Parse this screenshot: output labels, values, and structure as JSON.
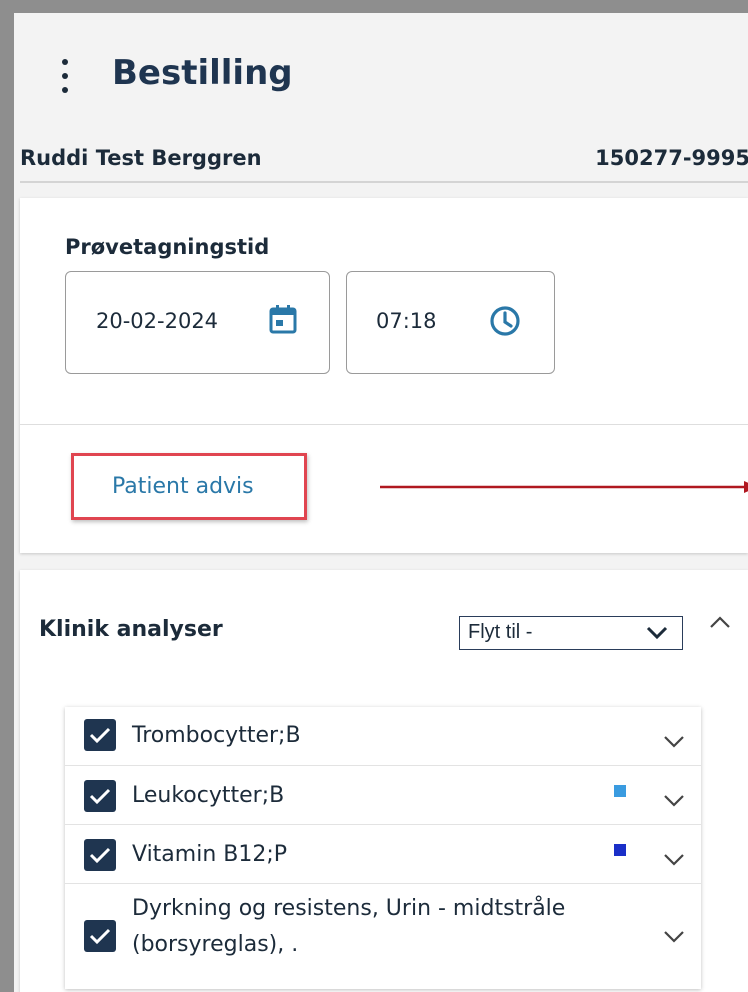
{
  "header": {
    "title": "Bestilling",
    "menu_icon": "kebab-menu-icon"
  },
  "patient": {
    "name": "Ruddi Test Berggren",
    "id": "150277-9995"
  },
  "sampling": {
    "label": "Prøvetagningstid",
    "date": "20-02-2024",
    "time": "07:18",
    "date_icon": "calendar-icon",
    "time_icon": "clock-icon"
  },
  "advis": {
    "label": "Patient advis",
    "highlight_color": "#e04550",
    "arrow_color": "#b01820"
  },
  "analyses": {
    "title": "Klinik analyser",
    "move_to": "Flyt til -",
    "items": [
      {
        "label": "Trombocytter;B",
        "checked": true,
        "marker_color": ""
      },
      {
        "label": "Leukocytter;B",
        "checked": true,
        "marker_color": "#3a9be0"
      },
      {
        "label": "Vitamin B12;P",
        "checked": true,
        "marker_color": "#1a2fc8"
      },
      {
        "label": "Dyrkning og resistens, Urin - midtstråle (borsyreglas), .",
        "checked": true,
        "marker_color": ""
      }
    ]
  },
  "colors": {
    "accent": "#1f3550",
    "link": "#2a78a8"
  }
}
